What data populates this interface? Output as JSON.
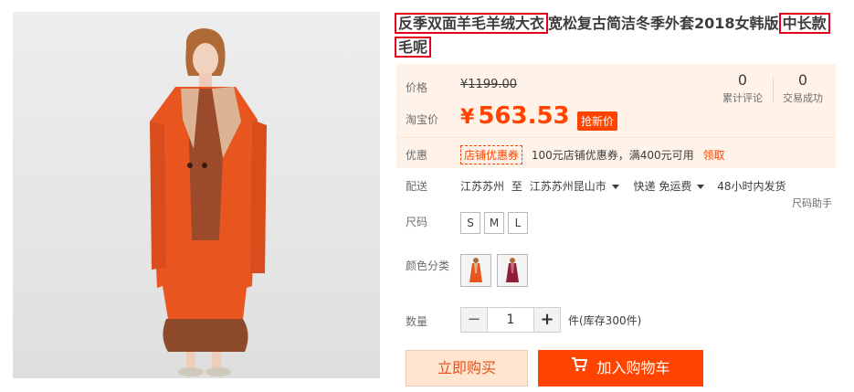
{
  "product": {
    "title_part1": "反季双面羊毛羊绒大衣",
    "title_part2": "宽松复古简洁冬季外套2018女韩版",
    "title_part3": "中长款",
    "title_part4": "毛呢"
  },
  "price": {
    "label": "价格",
    "original": "¥1199.00",
    "taobao_label": "淘宝价",
    "currency": "¥",
    "current": "563.53",
    "badge": "抢新价"
  },
  "stats": {
    "reviews_count": "0",
    "reviews_label": "累计评论",
    "deals_count": "0",
    "deals_label": "交易成功"
  },
  "promo": {
    "label": "优惠",
    "tag": "店铺优惠券",
    "text": "100元店铺优惠券，满400元可用",
    "link": "领取"
  },
  "shipping": {
    "label": "配送",
    "from": "江苏苏州",
    "to_word": "至",
    "to": "江苏苏州昆山市",
    "method": "快递 免运费",
    "time": "48小时内发货",
    "size_helper": "尺码助手"
  },
  "size": {
    "label": "尺码",
    "options": [
      "S",
      "M",
      "L"
    ]
  },
  "color": {
    "label": "颜色分类",
    "options": [
      "orange-coat",
      "burgundy-dress"
    ]
  },
  "quantity": {
    "label": "数量",
    "value": "1",
    "minus": "−",
    "plus": "+",
    "stock": "件(库存300件)"
  },
  "actions": {
    "buy_now": "立即购买",
    "add_to_cart": "加入购物车"
  },
  "colors": {
    "accent": "#ff4400",
    "highlight_border": "#e4001b",
    "price_panel_bg": "#fff2e8"
  }
}
